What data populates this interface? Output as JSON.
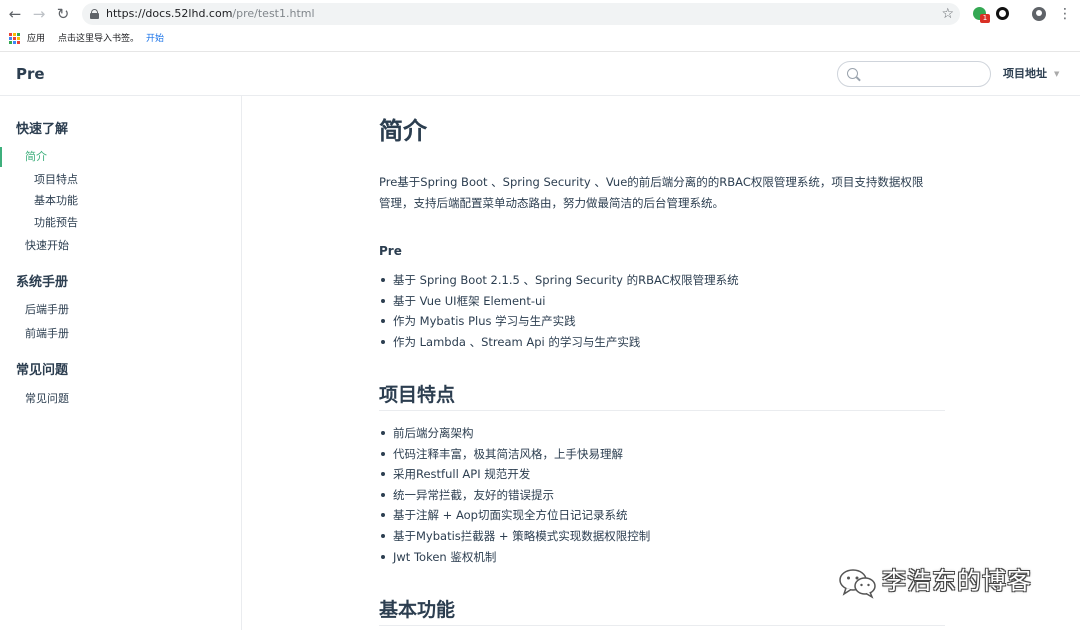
{
  "browser": {
    "url_host": "https://docs.52lhd.com",
    "url_path": "/pre/test1.html",
    "bookmarks": {
      "apps_label": "应用",
      "import_hint": "点击这里导入书签。",
      "start_link": "开始"
    },
    "extension_badge": "1",
    "apps_colors": [
      "#ea4335",
      "#fbbc05",
      "#34a853",
      "#4285f4",
      "#ea4335",
      "#fbbc05",
      "#34a853",
      "#4285f4",
      "#ea4335"
    ]
  },
  "header": {
    "logo": "Pre",
    "search": {
      "value": "",
      "placeholder": ""
    },
    "project_link": "项目地址",
    "caret": "▼"
  },
  "sidebar": {
    "groups": [
      {
        "title": "快速了解",
        "items": [
          {
            "label": "简介",
            "active": true
          },
          {
            "label": "项目特点"
          },
          {
            "label": "基本功能"
          },
          {
            "label": "功能预告"
          },
          {
            "label": "快速开始"
          }
        ]
      },
      {
        "title": "系统手册",
        "items": [
          {
            "label": "后端手册"
          },
          {
            "label": "前端手册"
          }
        ]
      },
      {
        "title": "常见问题",
        "items": [
          {
            "label": "常见问题"
          }
        ]
      }
    ]
  },
  "content": {
    "title": "简介",
    "intro_line1": "Pre基于Spring Boot 、Spring Security 、Vue的前后端分离的的RBAC权限管理系统，项目支持数据权限",
    "intro_line2": "管理，支持后端配置菜单动态路由，努力做最简洁的后台管理系统。",
    "pre_heading": "Pre",
    "pre_items": [
      "基于 Spring Boot 2.1.5 、Spring Security 的RBAC权限管理系统",
      "基于 Vue UI框架 Element-ui",
      "作为 Mybatis Plus 学习与生产实践",
      "作为 Lambda 、Stream Api 的学习与生产实践"
    ],
    "features_heading": "项目特点",
    "features": [
      "前后端分离架构",
      "代码注释丰富，极其简洁风格，上手快易理解",
      "采用Restfull API 规范开发",
      "统一异常拦截，友好的错误提示",
      "基于注解 + Aop切面实现全方位日记记录系统",
      "基于Mybatis拦截器 + 策略模式实现数据权限控制",
      "Jwt Token 鉴权机制"
    ],
    "basic_heading": "基本功能"
  },
  "watermark": {
    "text": "李浩东的博客"
  },
  "colors": {
    "accent": "#3eaf7c",
    "text": "#2c3e50",
    "border": "#eaecef"
  }
}
